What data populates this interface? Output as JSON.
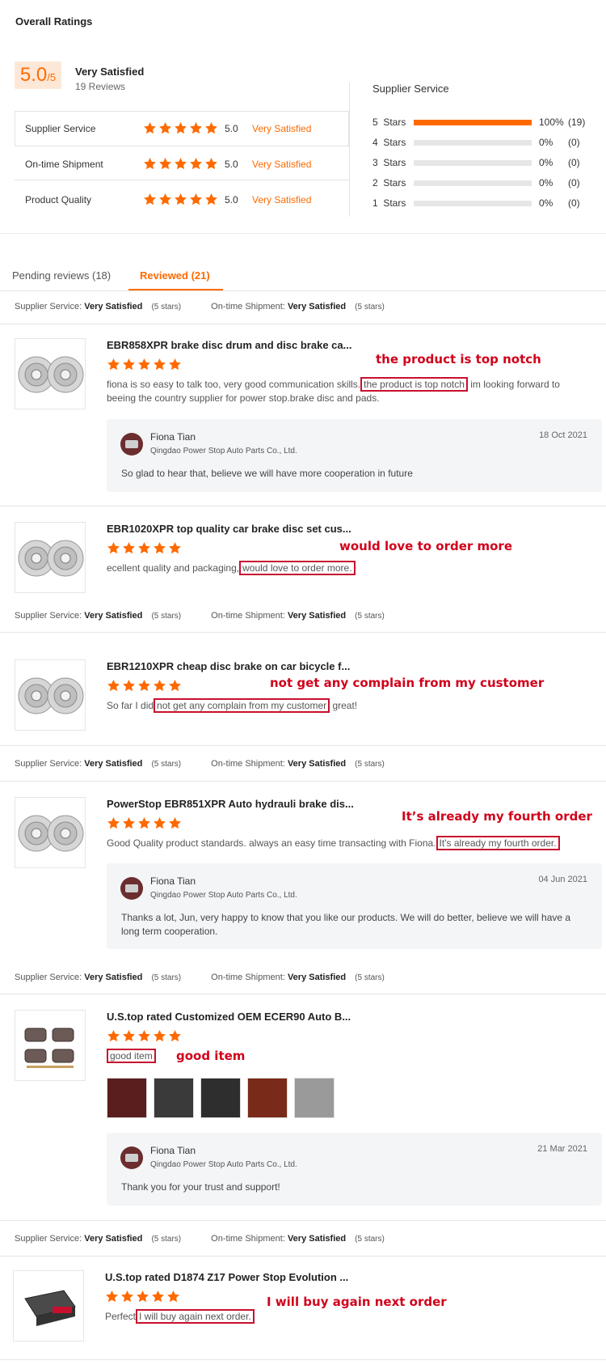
{
  "overall": {
    "heading": "Overall Ratings",
    "score": "5.0",
    "score_den": "/5",
    "label": "Very Satisfied",
    "reviews": "19 Reviews",
    "criteria": [
      {
        "name": "Supplier Service",
        "score": "5.0",
        "label": "Very Satisfied",
        "stars": 5
      },
      {
        "name": "On-time Shipment",
        "score": "5.0",
        "label": "Very Satisfied",
        "stars": 5
      },
      {
        "name": "Product Quality",
        "score": "5.0",
        "label": "Very Satisfied",
        "stars": 5
      }
    ]
  },
  "breakdown": {
    "title": "Supplier Service",
    "rows": [
      {
        "label": "5  Stars",
        "pct": "100%",
        "count": "(19)",
        "fill": 1.0
      },
      {
        "label": "4  Stars",
        "pct": "0%",
        "count": "(0)",
        "fill": 0
      },
      {
        "label": "3  Stars",
        "pct": "0%",
        "count": "(0)",
        "fill": 0
      },
      {
        "label": "2  Stars",
        "pct": "0%",
        "count": "(0)",
        "fill": 0
      },
      {
        "label": "1  Stars",
        "pct": "0%",
        "count": "(0)",
        "fill": 0
      }
    ]
  },
  "tabs": {
    "pending": "Pending reviews (18)",
    "reviewed": "Reviewed (21)"
  },
  "summary": {
    "supplier_label": "Supplier Service:",
    "shipment_label": "On-time Shipment:",
    "value": "Very Satisfied",
    "stars_note": "(5 stars)"
  },
  "reviews": [
    {
      "title": "EBR858XPR brake disc drum and disc brake ca...",
      "pre": "fiona is so easy to talk too, very good communication skills.",
      "highlight": "the product is top notch",
      "post": " im looking forward to beeing the country supplier for power stop.brake disc and pads.",
      "annotation": "the product is top notch",
      "reply": {
        "name": "Fiona Tian",
        "company": "Qingdao Power Stop Auto Parts Co., Ltd.",
        "date": "18 Oct 2021",
        "text": "So glad to hear that, believe we will have more cooperation in future"
      }
    },
    {
      "title": "EBR1020XPR top quality car brake disc set cus...",
      "pre": "ecellent quality and packaging,",
      "highlight": "would love to order more.",
      "post": "",
      "annotation": "would love to order more"
    },
    {
      "title": "EBR1210XPR cheap disc brake on car bicycle f...",
      "pre": "So far I did",
      "highlight": "not get any complain from my customer",
      "post": " great!",
      "annotation": "not get any complain from my customer"
    },
    {
      "title": "PowerStop EBR851XPR Auto hydrauli brake dis...",
      "pre": "Good Quality product standards. always an easy time transacting with Fiona.",
      "highlight": "It's already my fourth order.",
      "post": "",
      "annotation": "It’s already my fourth order",
      "reply": {
        "name": "Fiona Tian",
        "company": "Qingdao Power Stop Auto Parts Co., Ltd.",
        "date": "04 Jun 2021",
        "text": "Thanks a lot, Jun, very happy to know that you like our products. We will do better, believe we will have a long term cooperation."
      }
    },
    {
      "title": "U.S.top rated Customized OEM ECER90 Auto B...",
      "pre": "",
      "highlight": "good item",
      "post": "",
      "annotation": "good item",
      "reply": {
        "name": "Fiona Tian",
        "company": "Qingdao Power Stop Auto Parts Co., Ltd.",
        "date": "21 Mar 2021",
        "text": "Thank you for your trust and support!"
      }
    },
    {
      "title": "U.S.top rated D1874 Z17 Power Stop Evolution ...",
      "pre": "Perfect",
      "highlight": "I will buy again next order.",
      "post": "",
      "annotation": "I will buy again next order"
    }
  ],
  "colors": {
    "accent": "#ff6a00",
    "annotation_red": "#d0021b",
    "reply_bg": "#f4f5f7"
  },
  "icons": [
    "star-icon",
    "brake-disc-thumbnail",
    "brake-pad-thumbnail",
    "avatar"
  ]
}
